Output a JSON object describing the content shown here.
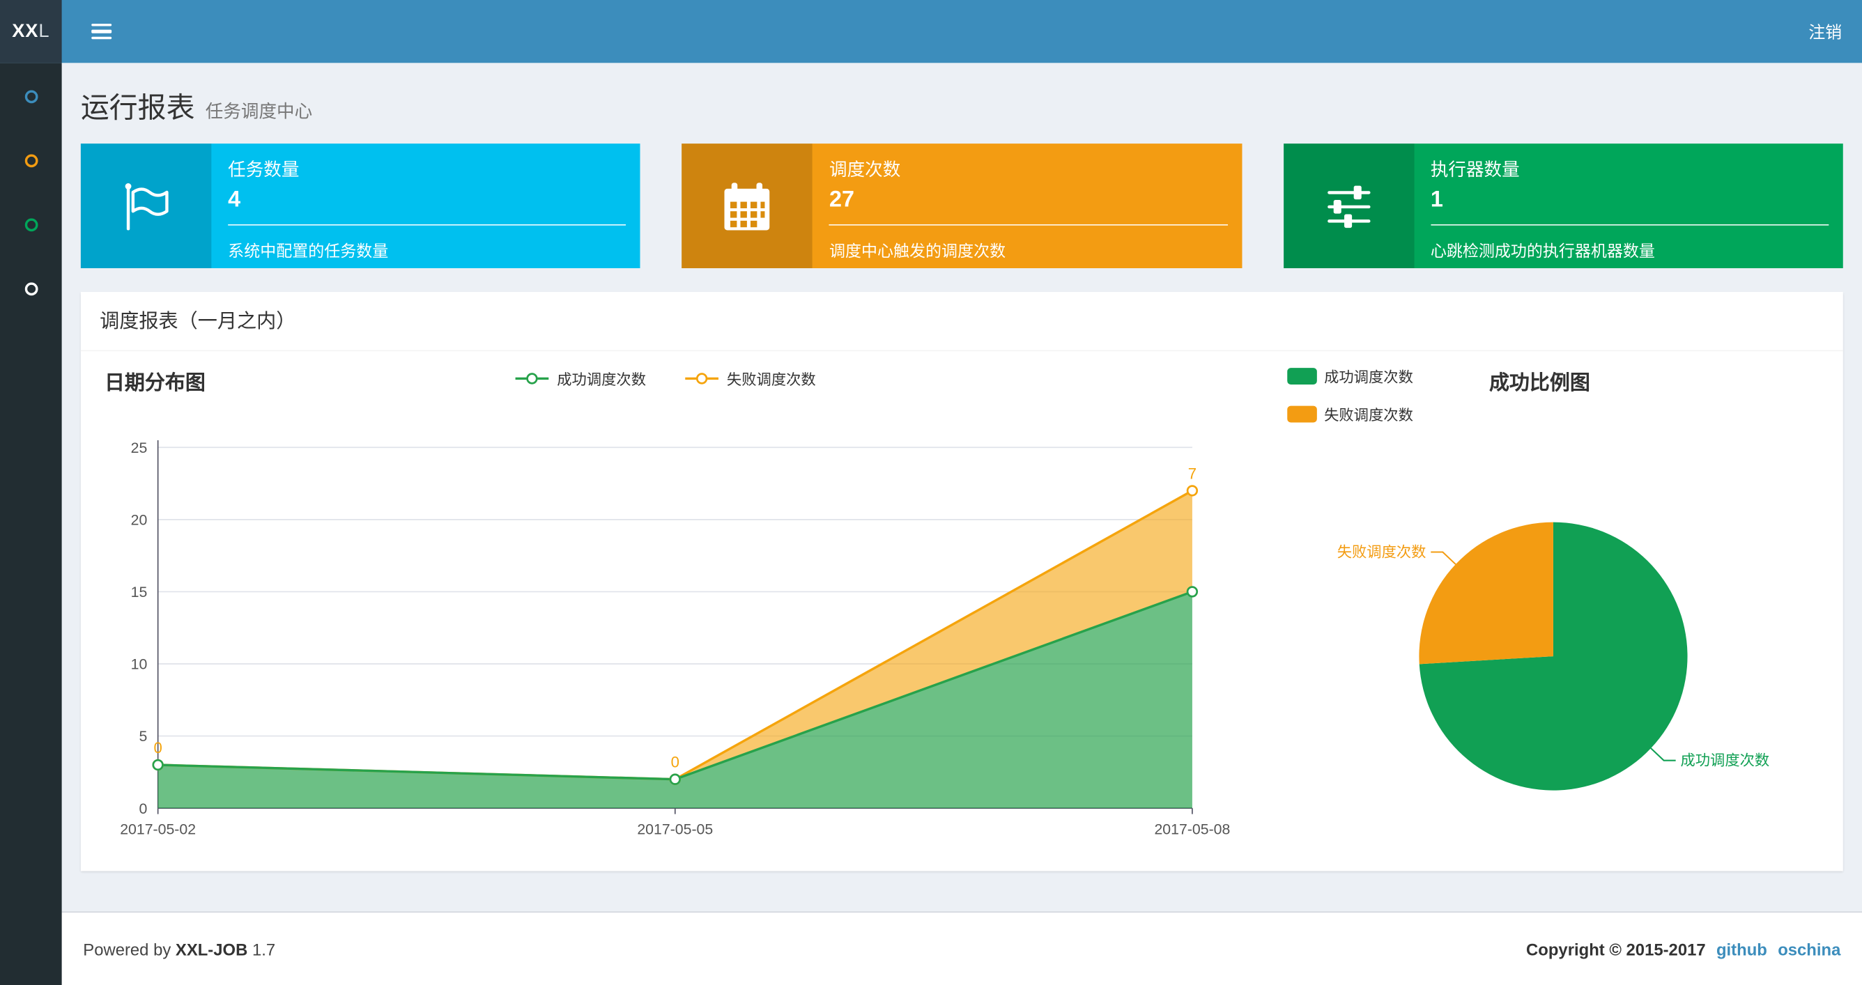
{
  "navbar": {
    "logo_bold": "XX",
    "logo_light": "L",
    "menu_toggle_icon": "hamburger-icon",
    "logout_label": "注销",
    "color": "#3c8dbc"
  },
  "sidebar": {
    "items": [
      {
        "icon": "circle-icon",
        "color": "#3c8dbc"
      },
      {
        "icon": "circle-icon",
        "color": "#f39c12"
      },
      {
        "icon": "circle-icon",
        "color": "#00a65a"
      },
      {
        "icon": "circle-icon",
        "color": "#ffffff"
      }
    ]
  },
  "page": {
    "title": "运行报表",
    "subtitle": "任务调度中心"
  },
  "info_boxes": [
    {
      "icon": "flag-icon",
      "label": "任务数量",
      "value": "4",
      "desc": "系统中配置的任务数量",
      "color": "#00c0ef"
    },
    {
      "icon": "calendar-icon",
      "label": "调度次数",
      "value": "27",
      "desc": "调度中心触发的调度次数",
      "color": "#f39c12"
    },
    {
      "icon": "sliders-icon",
      "label": "执行器数量",
      "value": "1",
      "desc": "心跳检测成功的执行器机器数量",
      "color": "#00a65a"
    }
  ],
  "panel": {
    "title": "调度报表（一月之内）"
  },
  "chart_data": [
    {
      "type": "area",
      "title": "日期分布图",
      "x": [
        "2017-05-02",
        "2017-05-05",
        "2017-05-08"
      ],
      "series": [
        {
          "name": "成功调度次数",
          "values": [
            3,
            2,
            15
          ],
          "color": "#27a24b"
        },
        {
          "name": "失败调度次数",
          "values": [
            0,
            0,
            7
          ],
          "color": "#f5a40c"
        }
      ],
      "stacked": true,
      "point_labels_series": "失败调度次数",
      "point_labels": [
        0,
        0,
        7
      ],
      "ylim": [
        0,
        25
      ],
      "yticks": [
        0,
        5,
        10,
        15,
        20,
        25
      ],
      "grid": true,
      "legend_position": "top-center"
    },
    {
      "type": "pie",
      "title": "成功比例图",
      "slices": [
        {
          "name": "成功调度次数",
          "value": 20,
          "color": "#11a054"
        },
        {
          "name": "失败调度次数",
          "value": 7,
          "color": "#f39c12"
        }
      ],
      "legend_position": "top-left"
    }
  ],
  "footer": {
    "powered_prefix": "Powered by",
    "product": "XXL-JOB",
    "version": "1.7",
    "copyright": "Copyright © 2015-2017",
    "links": [
      "github",
      "oschina"
    ]
  }
}
